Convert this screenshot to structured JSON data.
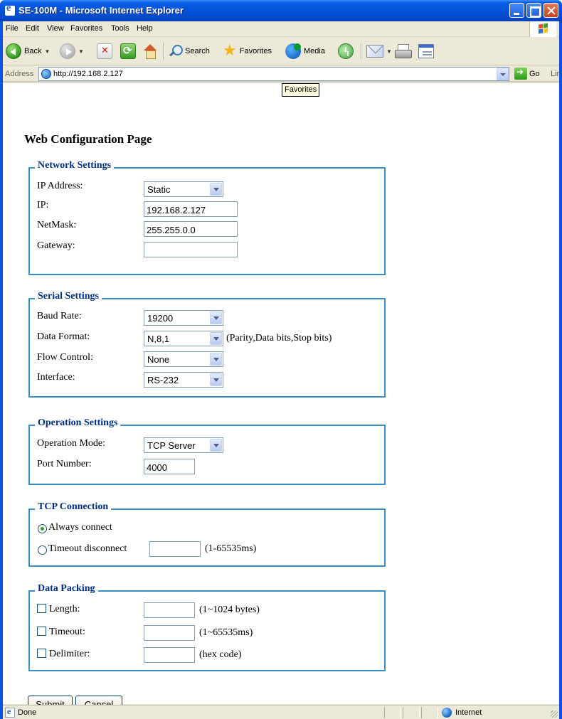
{
  "window": {
    "title": "SE-100M - Microsoft Internet Explorer"
  },
  "menu": [
    "File",
    "Edit",
    "View",
    "Favorites",
    "Tools",
    "Help"
  ],
  "toolbar": {
    "back_label": "Back",
    "search_label": "Search",
    "favorites_label": "Favorites",
    "media_label": "Media"
  },
  "address": {
    "label": "Address",
    "url": "http://192.168.2.127",
    "go_label": "Go",
    "links_label": "Links",
    "links_chevron": "»"
  },
  "tooltip": "Favorites",
  "page": {
    "heading": "Web Configuration Page",
    "network": {
      "legend": "Network Settings",
      "ip_address_label": "IP Address:",
      "ip_address_value": "Static",
      "ip_label": "IP:",
      "ip_value": "192.168.2.127",
      "netmask_label": "NetMask:",
      "netmask_value": "255.255.0.0",
      "gateway_label": "Gateway:",
      "gateway_value": ""
    },
    "serial": {
      "legend": "Serial Settings",
      "baud_label": "Baud Rate:",
      "baud_value": "19200",
      "format_label": "Data Format:",
      "format_value": "N,8,1",
      "format_note": "(Parity,Data bits,Stop bits)",
      "flow_label": "Flow Control:",
      "flow_value": "None",
      "interface_label": "Interface:",
      "interface_value": "RS-232"
    },
    "operation": {
      "legend": "Operation Settings",
      "mode_label": "Operation Mode:",
      "mode_value": "TCP Server",
      "port_label": "Port Number:",
      "port_value": "4000"
    },
    "tcp": {
      "legend": "TCP Connection",
      "always_label": "Always connect",
      "always_selected": true,
      "timeout_label": "Timeout disconnect",
      "timeout_value": "",
      "timeout_note": "(1-65535ms)"
    },
    "packing": {
      "legend": "Data Packing",
      "length_label": "Length:",
      "length_note": "(1~1024 bytes)",
      "timeout_label": "Timeout:",
      "timeout_note": "(1~65535ms)",
      "delimiter_label": "Delimiter:",
      "delimiter_note": "(hex code)"
    },
    "submit_label": "Submit",
    "cancel_label": "Cancel"
  },
  "status": {
    "text": "Done",
    "zone": "Internet"
  },
  "colors": {
    "fieldset_border": "#3890c8",
    "legend_text": "#00308a",
    "titlebar": "#0352d8"
  }
}
